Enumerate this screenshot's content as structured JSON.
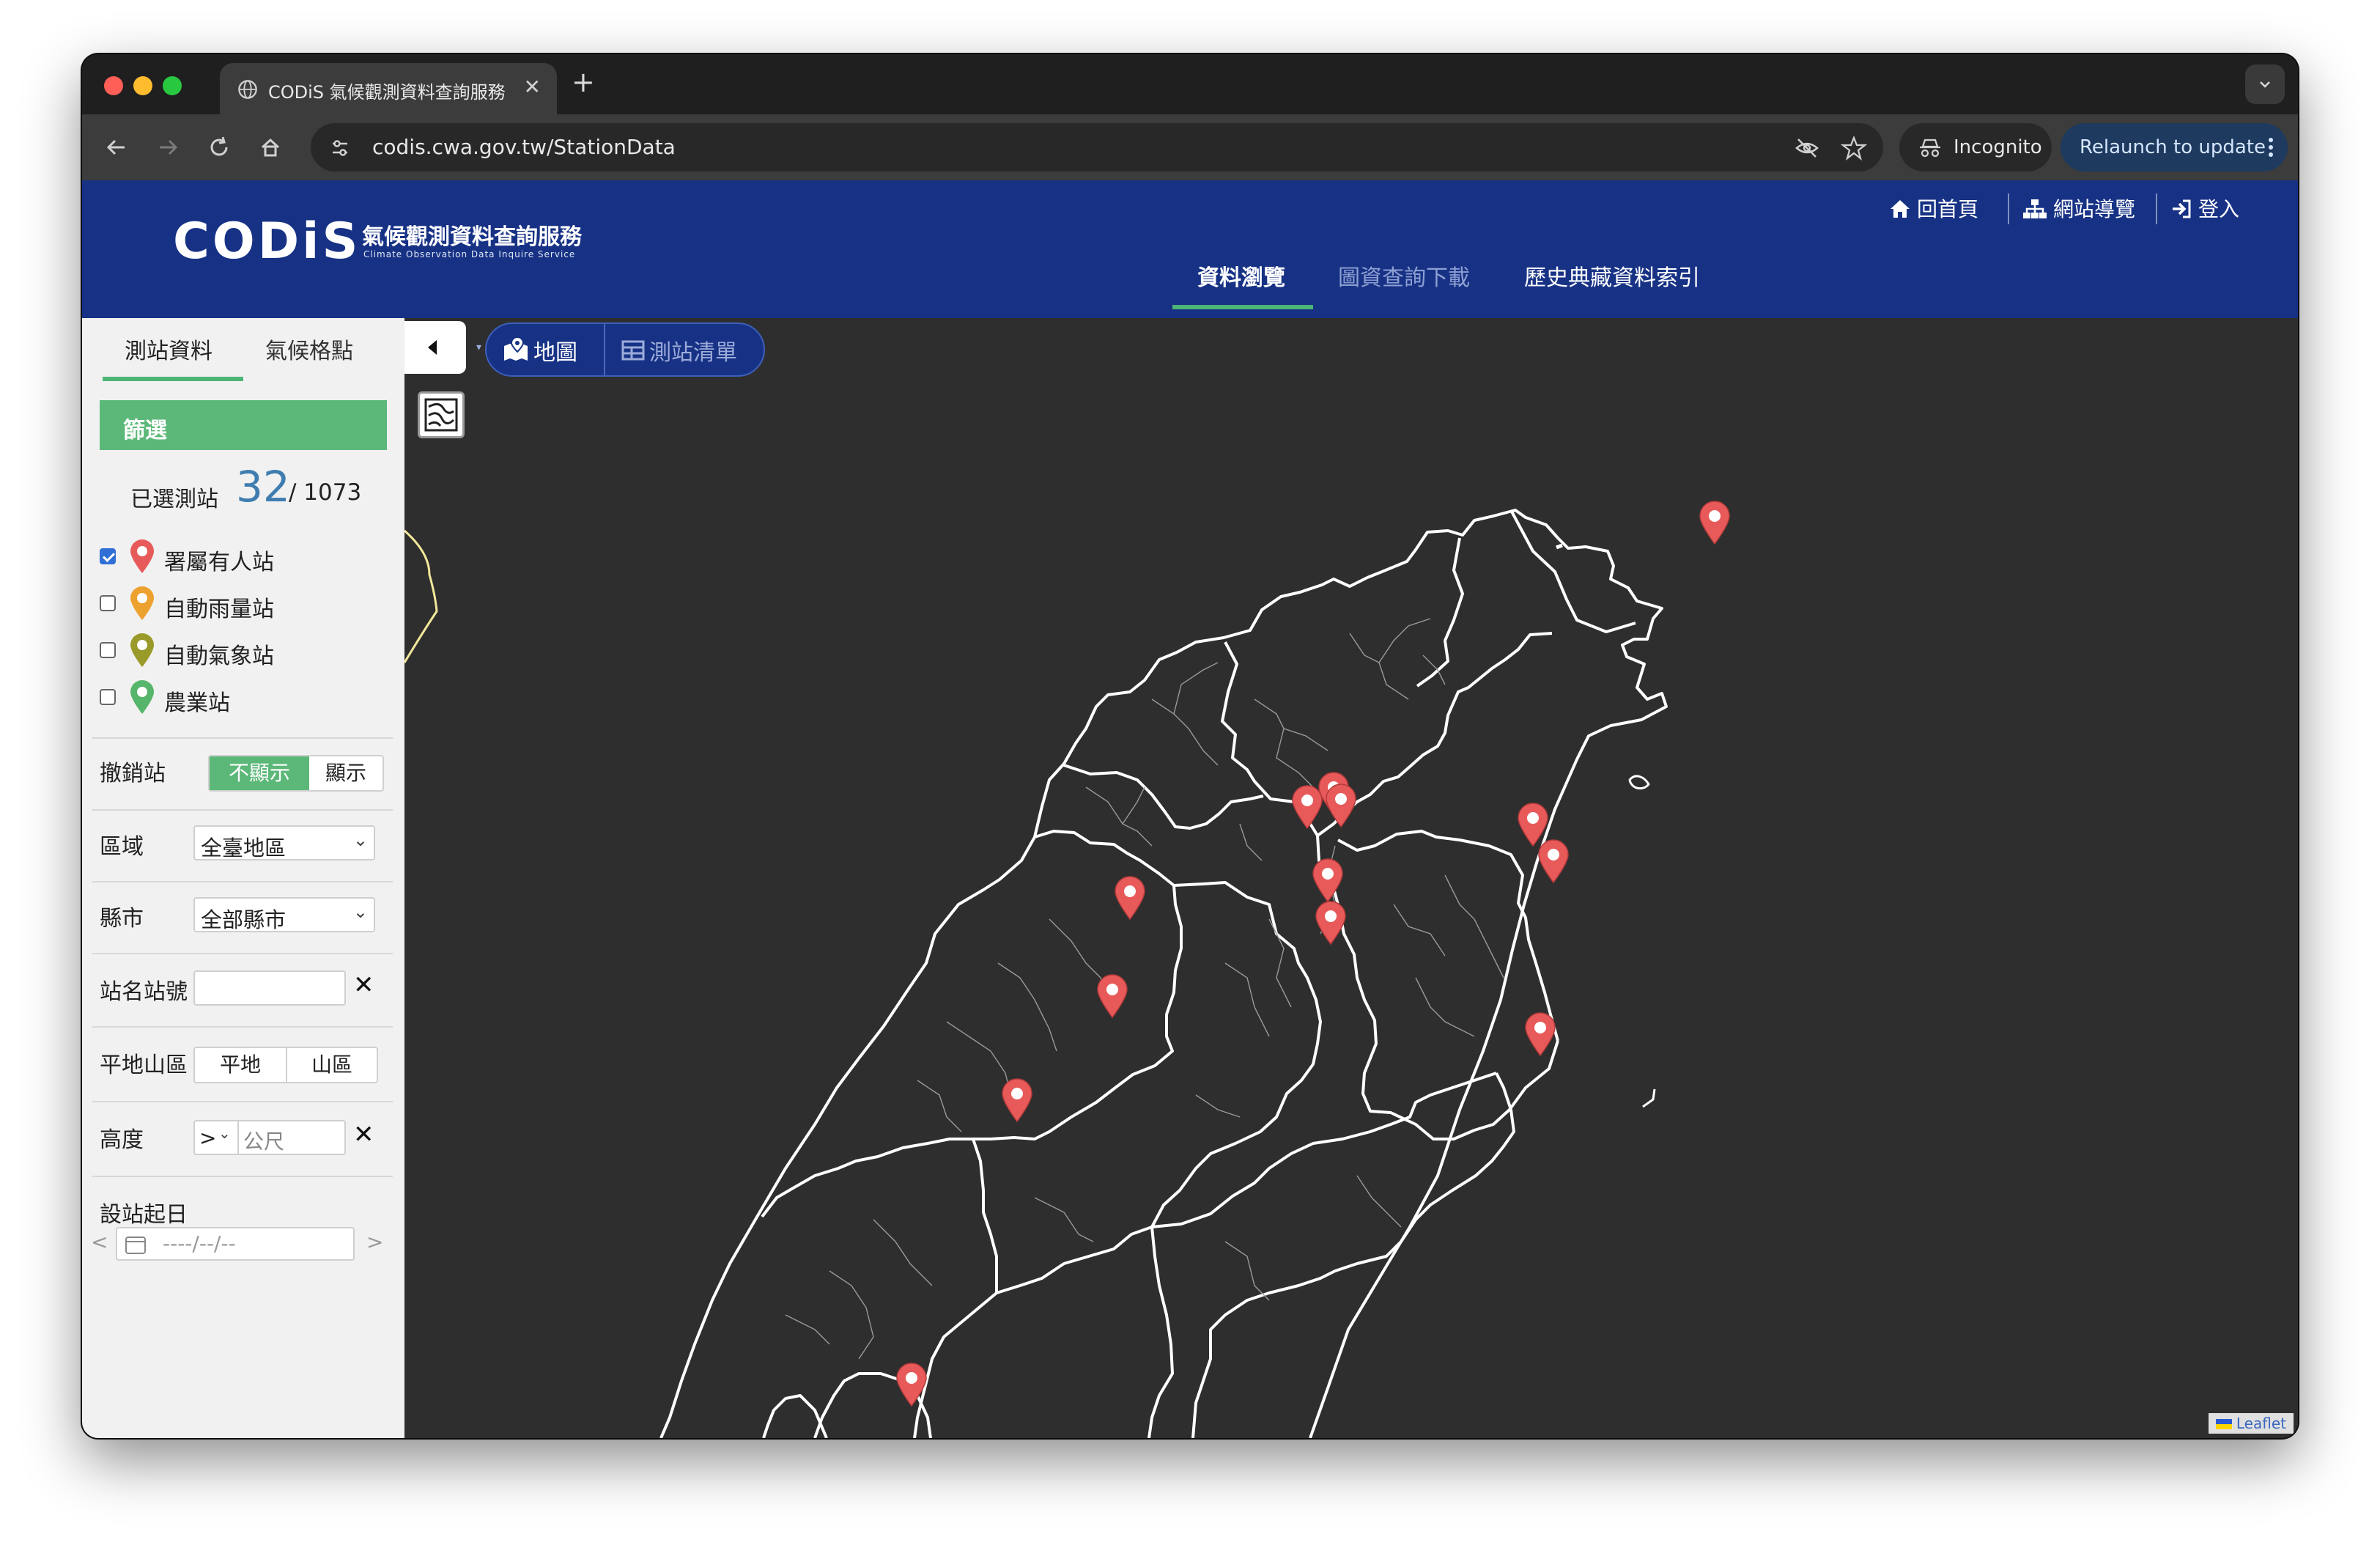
{
  "browser": {
    "tab_title": "CODiS 氣候觀測資料查詢服務",
    "new_tab": "+",
    "close_tab": "✕",
    "url": "codis.cwa.gov.tw/StationData",
    "incognito_label": "Incognito",
    "relaunch_label": "Relaunch to update",
    "colors": {
      "close": "#ff5f57",
      "minimize": "#febc2e",
      "maximize": "#28c840"
    }
  },
  "header": {
    "logo": "CODiS",
    "brand_zh": "氣候觀測資料查詢服務",
    "brand_en": "Climate Observation Data Inquire Service",
    "top_links": {
      "home": "回首頁",
      "sitemap": "網站導覽",
      "login": "登入"
    },
    "main_nav": {
      "browse": "資料瀏覽",
      "download": "圖資查詢下載",
      "archive": "歷史典藏資料索引"
    }
  },
  "sidebar": {
    "tabs": {
      "station": "測站資料",
      "grid": "氣候格點"
    },
    "filter_title": "篩選",
    "selected_label": "已選測站",
    "selected_count": "32",
    "selected_total": "/ 1073",
    "station_types": [
      {
        "label": "署屬有人站",
        "checked": true,
        "color": "#e75a5a"
      },
      {
        "label": "自動雨量站",
        "checked": false,
        "color": "#eda12e"
      },
      {
        "label": "自動氣象站",
        "checked": false,
        "color": "#9a9a2a"
      },
      {
        "label": "農業站",
        "checked": false,
        "color": "#55b56a"
      }
    ],
    "revoked": {
      "label": "撤銷站",
      "hide": "不顯示",
      "show": "顯示"
    },
    "region": {
      "label": "區域",
      "value": "全臺地區"
    },
    "county": {
      "label": "縣市",
      "value": "全部縣市"
    },
    "station_name": {
      "label": "站名站號",
      "value": ""
    },
    "terrain": {
      "label": "平地山區",
      "flat": "平地",
      "mountain": "山區"
    },
    "altitude": {
      "label": "高度",
      "op": ">",
      "placeholder": "公尺"
    },
    "start_date": {
      "label": "設站起日",
      "placeholder": "----/--/--",
      "prev": "<",
      "next": ">"
    }
  },
  "map": {
    "view_map": "地圖",
    "view_list": "測站清單",
    "attribution": "Leaflet",
    "marker_color": "#e85a5a",
    "station_marker_count": 16
  }
}
